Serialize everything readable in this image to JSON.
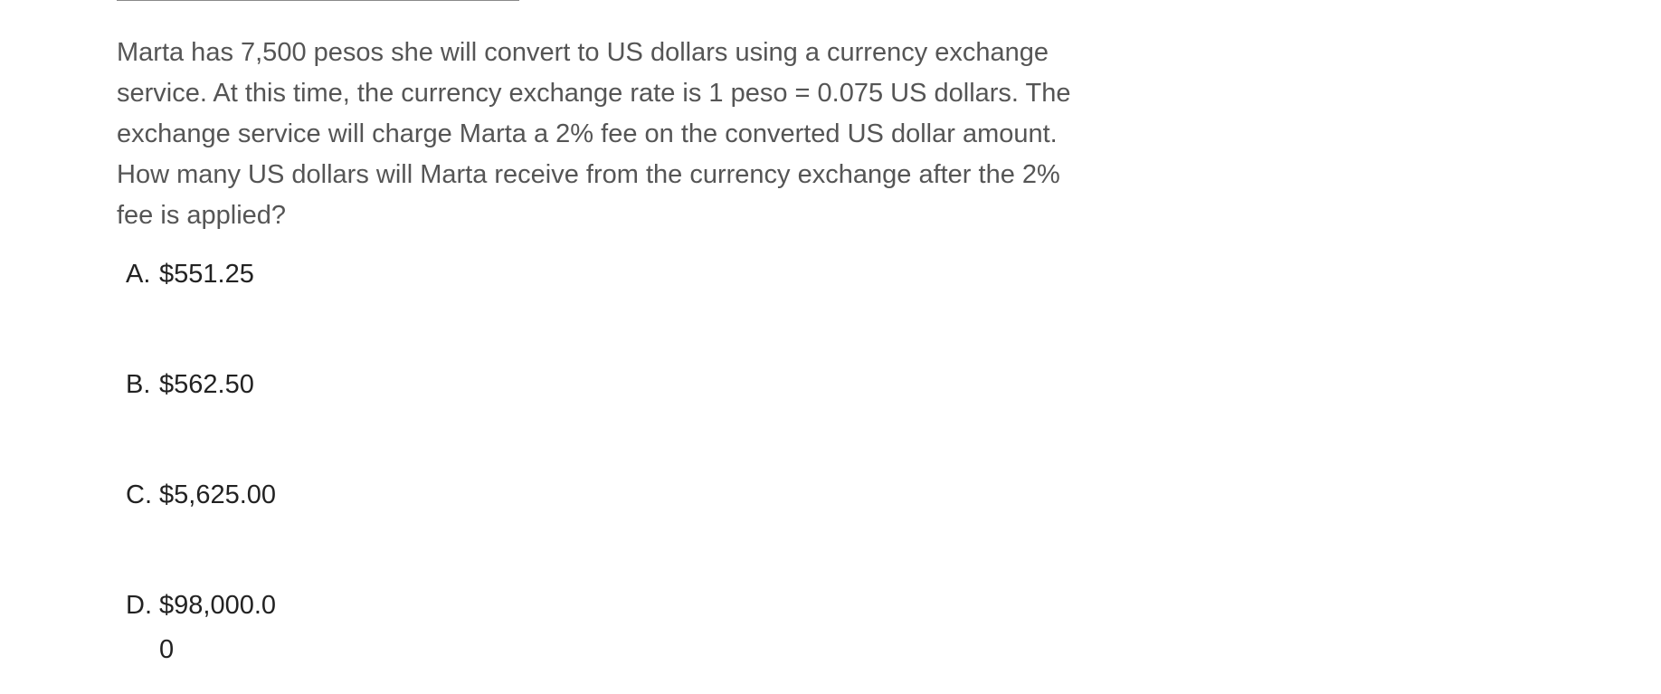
{
  "question": {
    "text": "Marta has 7,500 pesos she will convert to US dollars using a currency exchange service. At this time, the currency exchange rate is 1 peso = 0.075 US dollars. The exchange service will charge Marta a 2% fee on the converted US dollar amount. How many US dollars will Marta receive from the currency exchange after the 2% fee is applied?"
  },
  "choices": [
    {
      "letter": "A.",
      "text": "$551.25"
    },
    {
      "letter": "B.",
      "text": "$562.50"
    },
    {
      "letter": "C.",
      "text": "$5,625.00"
    },
    {
      "letter": "D.",
      "text": "$98,000.00"
    }
  ]
}
